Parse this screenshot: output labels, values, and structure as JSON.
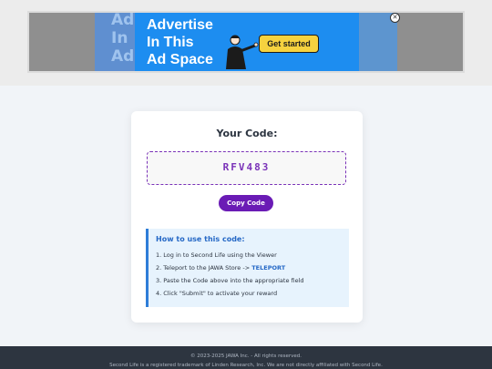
{
  "ad": {
    "headline_line1": "Advertise",
    "headline_line2": "In This",
    "headline_line3": "Ad Space",
    "cta": "Get started",
    "ghost_line1": "Ad",
    "ghost_line2": "In",
    "ghost_line3": "Ad",
    "close_glyph": "✕",
    "colors": {
      "blue": "#1d8df0",
      "cta": "#f6d23f"
    }
  },
  "card": {
    "title": "Your Code:",
    "code": "RFV483",
    "copy_label": "Copy Code",
    "colors": {
      "accent": "#6a1bb5"
    }
  },
  "howto": {
    "title": "How to use this code:",
    "step1": "1. Log in to Second Life using the Viewer",
    "step2_prefix": "2. Teleport to the JAWA Store ->",
    "step2_link": "TELEPORT",
    "step3": "3. Paste the Code above into the appropriate field",
    "step4": "4. Click \"Submit\" to activate your reward"
  },
  "footer": {
    "line1": "© 2023-2025 JAWA Inc. - All rights reserved.",
    "line2": "Second Life is a registered trademark of Linden Research, Inc. We are not directly affiliated with Second Life."
  }
}
